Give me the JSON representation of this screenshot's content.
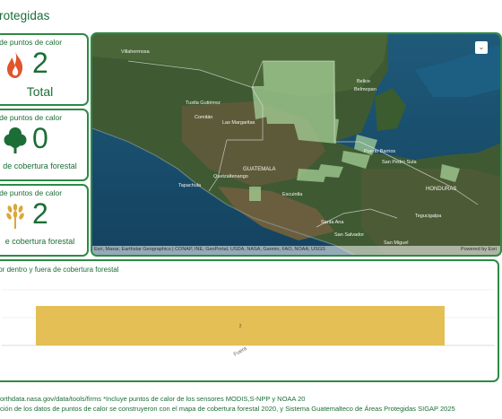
{
  "header": {
    "title": "rotegidas"
  },
  "stats": [
    {
      "label": "o de puntos de calor",
      "value": "2",
      "caption": "Total",
      "icon": "fire-icon",
      "color": "#e0552b"
    },
    {
      "label": "o de puntos de calor",
      "value": "0",
      "caption": "de cobertura forestal",
      "icon": "tree-icon",
      "color": "#1b6e35"
    },
    {
      "label": "o de puntos de calor",
      "value": "2",
      "caption": "e cobertura forestal",
      "icon": "wheat-icon",
      "color": "#d9a83a"
    }
  ],
  "map": {
    "expand_icon": "expand-icon",
    "labels": {
      "mexico_city": "Villahermosa",
      "belize": "Belice",
      "guatemala": "GUATEMALA",
      "honduras": "HONDURAS",
      "san_pedro_sula": "San Pedro Sula",
      "tegucigalpa": "Tegucigalpa",
      "san_salvador": "San Salvador",
      "tapachula": "Tapachula",
      "las_margaritas": "Las Margaritas",
      "tuxtla": "Tuxtla Gutiérrez",
      "quetzaltenango": "Quetzaltenango",
      "santa_ana": "Santa Ana",
      "san_miguel": "San Miguel",
      "belmopan": "Belmopan",
      "puerto_barrios": "Puerto Barrios",
      "comitan": "Comitán",
      "escuintla": "Escuintla"
    },
    "attribution": "Esri, Maxar, Earthstar Geographics | CONAP, INE, GeoPortal, USDA, NASA, Garmin, FAO, NOAA, USGS",
    "powered_by": "Powered by Esri"
  },
  "chart": {
    "title": "alor dentro y fuera de cobertura forestal"
  },
  "chart_data": {
    "type": "bar",
    "categories": [
      "Fuera"
    ],
    "values": [
      2
    ],
    "colors": [
      "#e3bf55"
    ],
    "grid": true,
    "legend": "none"
  },
  "footer": {
    "line1": "orthdata.nasa.gov/data/tools/firms *Incluye puntos de calor de los sensores MODIS,S-NPP y NOAA 20",
    "line2": "ción de los datos de puntos de calor se construyeron con el mapa de cobertura forestal 2020, y Sistema Guatemalteco de Áreas Protegidas SIGAP 2025"
  }
}
